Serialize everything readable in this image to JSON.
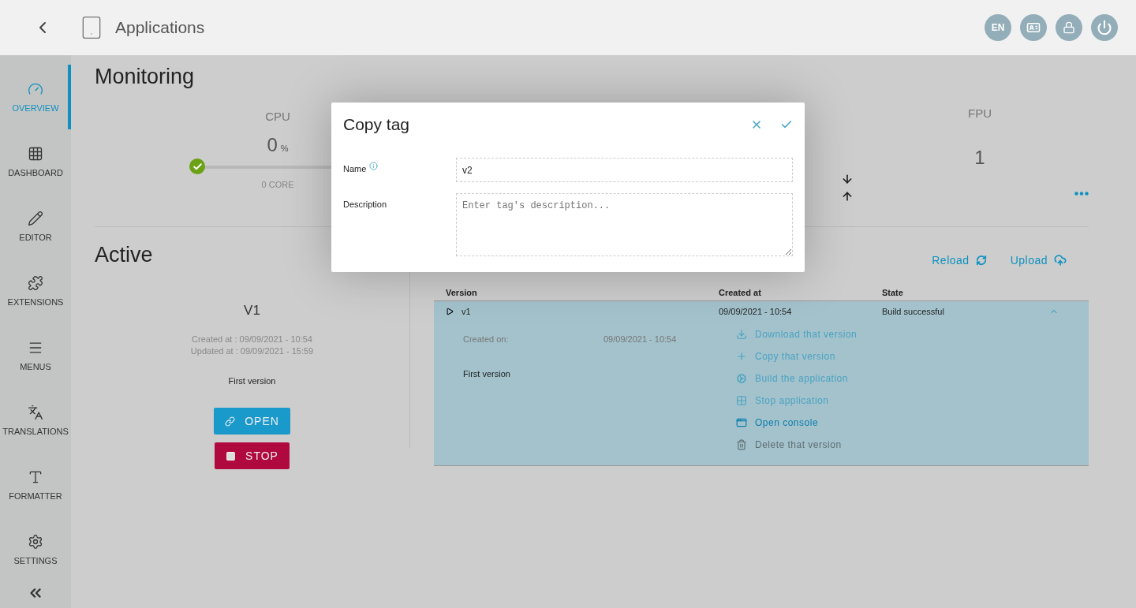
{
  "header": {
    "title": "Applications",
    "language": "EN"
  },
  "sidebar": {
    "items": [
      {
        "label": "OVERVIEW",
        "kind": "overview",
        "selected": true
      },
      {
        "label": "DASHBOARD",
        "kind": "dashboard",
        "selected": false
      },
      {
        "label": "EDITOR",
        "kind": "editor",
        "selected": false
      },
      {
        "label": "EXTENSIONS",
        "kind": "extensions",
        "selected": false
      },
      {
        "label": "MENUS",
        "kind": "menus",
        "selected": false
      },
      {
        "label": "TRANSLATIONS",
        "kind": "translations",
        "selected": false
      },
      {
        "label": "FORMATTER",
        "kind": "formatter",
        "selected": false
      },
      {
        "label": "SETTINGS",
        "kind": "settings",
        "selected": false
      }
    ]
  },
  "monitoring": {
    "title": "Monitoring",
    "cpu": {
      "label": "CPU",
      "value": "0",
      "unit": "%",
      "level": 0,
      "sub": "0 CORE"
    },
    "fpu": {
      "label": "FPU",
      "value": "1"
    }
  },
  "active": {
    "title": "Active",
    "version": "V1",
    "created": "Created at : 09/09/2021 - 10:54",
    "updated": "Updated at : 09/09/2021 - 15:59",
    "description": "First version",
    "buttons": [
      {
        "label": "OPEN",
        "kind": "open"
      },
      {
        "label": "STOP",
        "kind": "stop"
      }
    ]
  },
  "versions": {
    "toolbar": [
      {
        "label": "Reload",
        "kind": "reload"
      },
      {
        "label": "Upload",
        "kind": "upload"
      }
    ],
    "columns": [
      "Version",
      "Created at",
      "State"
    ],
    "rows": [
      {
        "version": "v1",
        "created": "09/09/2021 - 10:54",
        "state": "Build successful",
        "expanded": true,
        "details": {
          "created_label": "Created on:",
          "created_value": "09/09/2021 - 10:54",
          "description": "First version"
        },
        "actions": [
          {
            "label": "Download that version",
            "kind": "download",
            "emphasized": false,
            "disabled": false
          },
          {
            "label": "Copy that version",
            "kind": "copy",
            "emphasized": false,
            "disabled": false
          },
          {
            "label": "Build the application",
            "kind": "build",
            "emphasized": false,
            "disabled": false
          },
          {
            "label": "Stop application",
            "kind": "stop",
            "emphasized": false,
            "disabled": false
          },
          {
            "label": "Open console",
            "kind": "console",
            "emphasized": true,
            "disabled": false
          },
          {
            "label": "Delete that version",
            "kind": "delete",
            "emphasized": false,
            "disabled": true
          }
        ]
      }
    ]
  },
  "dialog": {
    "title": "Copy tag",
    "fields": [
      {
        "label": "Name",
        "value": "v2",
        "kind": "input",
        "has_info": true
      },
      {
        "label": "Description",
        "placeholder": "Enter tag's description...",
        "kind": "textarea",
        "has_info": false
      }
    ]
  }
}
